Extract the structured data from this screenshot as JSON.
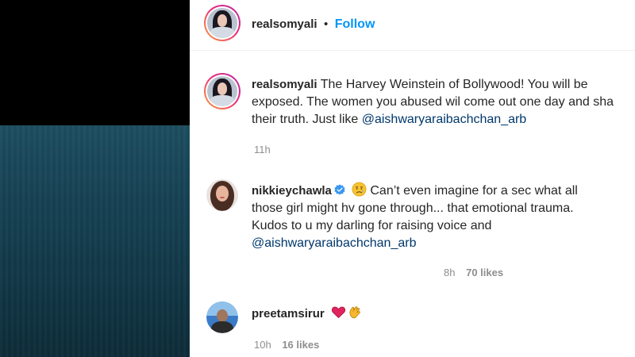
{
  "post": {
    "author": "realsomyali",
    "separator": "•",
    "follow_label": "Follow"
  },
  "caption": {
    "username": "realsomyali",
    "line1": "The Harvey Weinstein of Bollywood! You will be",
    "line2": "exposed. The women you abused wil come out one day and sha",
    "line3_prefix": "their truth. Just like ",
    "mention": "@aishwaryaraibachchan_arb",
    "time": "11h"
  },
  "comments": [
    {
      "username": "nikkieychawla",
      "verified": true,
      "emoji": "crying-face",
      "line1": "Can’t even imagine for a sec what all",
      "line2": "those girl might hv gone through... that emotional trauma.",
      "line3": "Kudos to u my darling for raising voice and",
      "mention": "@aishwaryaraibachchan_arb",
      "time": "8h",
      "likes": "70 likes"
    },
    {
      "username": "preetamsirur",
      "emojis": [
        "red-heart",
        "clapping-hands"
      ],
      "time": "10h",
      "likes": "16 likes"
    }
  ],
  "colors": {
    "follow": "#0095f6",
    "mention": "#00376b",
    "meta": "#8e8e8e",
    "text": "#262626",
    "verified": "#3897f0"
  }
}
